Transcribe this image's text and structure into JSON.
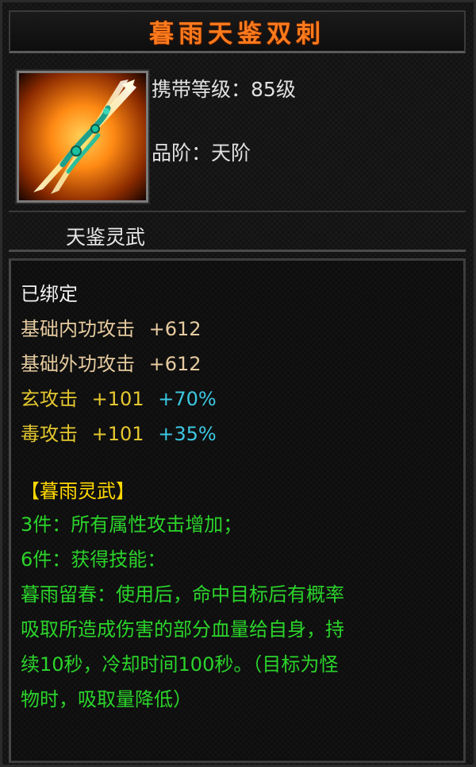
{
  "item": {
    "name": "暮雨天鉴双刺",
    "level_label": "携带等级：",
    "level_value": "85级",
    "grade_label": "品阶：",
    "grade_value": "天阶",
    "category": "天鉴灵武"
  },
  "stats": {
    "bound": "已绑定",
    "lines": [
      {
        "label": "基础内功攻击",
        "value": "+612"
      },
      {
        "label": "基础外功攻击",
        "value": "+612"
      },
      {
        "label": "玄攻击",
        "value": "+101",
        "bonus": "+70%"
      },
      {
        "label": "毒攻击",
        "value": "+101",
        "bonus": "+35%"
      }
    ]
  },
  "set": {
    "name": "【暮雨灵武】",
    "lines": [
      "3件：所有属性攻击增加；",
      "6件：获得技能：",
      "暮雨留春：使用后，命中目标后有概率",
      "吸取所造成伤害的部分血量给自身，持",
      "续10秒，冷却时间100秒。（目标为怪",
      "物时，吸取量降低）"
    ]
  },
  "colors": {
    "title": "#ff7a1c",
    "base_stat": "#e6cba0",
    "element_stat": "#e4c72f",
    "bonus": "#3cc8e2",
    "set_name": "#ffd800",
    "set_text": "#2bd42b"
  },
  "icon": "twin-daggers-weapon-icon"
}
